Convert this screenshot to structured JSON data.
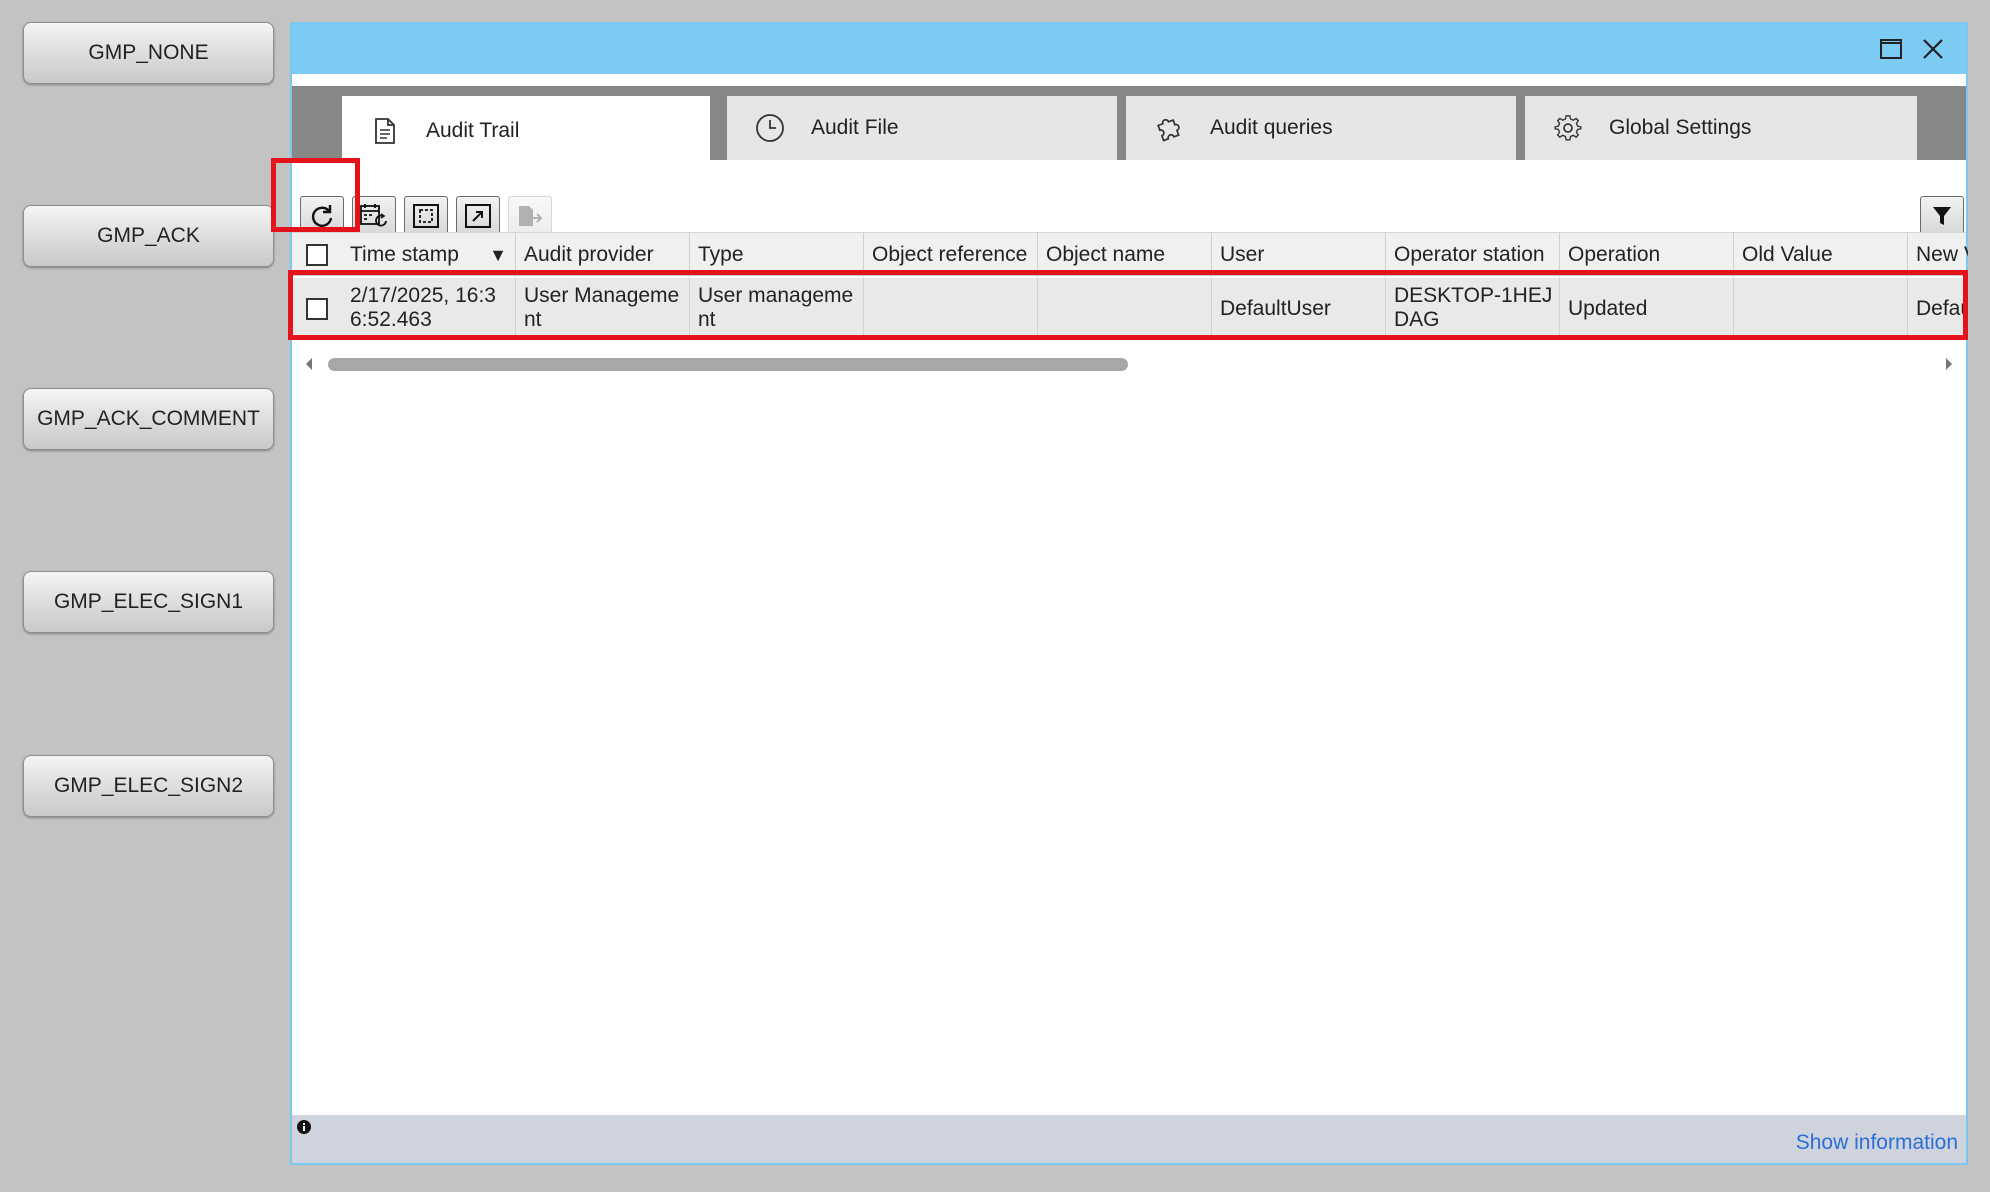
{
  "gmp_buttons": [
    {
      "label": "GMP_NONE"
    },
    {
      "label": "GMP_ACK"
    },
    {
      "label": "GMP_ACK_COMMENT"
    },
    {
      "label": "GMP_ELEC_SIGN1"
    },
    {
      "label": "GMP_ELEC_SIGN2"
    }
  ],
  "window": {
    "maximize_icon": "maximize-icon",
    "close_icon": "close-icon"
  },
  "tabs": [
    {
      "label": "Audit Trail",
      "icon": "document-icon",
      "active": true
    },
    {
      "label": "Audit File",
      "icon": "clock-icon",
      "active": false
    },
    {
      "label": "Audit queries",
      "icon": "puzzle-icon",
      "active": false
    },
    {
      "label": "Global Settings",
      "icon": "gear-icon",
      "active": false
    }
  ],
  "toolbar": {
    "buttons": [
      {
        "icon": "refresh-icon",
        "highlighted": true
      },
      {
        "icon": "calendar-refresh-icon"
      },
      {
        "icon": "select-area-icon"
      },
      {
        "icon": "move-icon"
      },
      {
        "icon": "export-icon",
        "disabled": true
      }
    ],
    "filter_icon": "filter-icon"
  },
  "grid": {
    "columns": [
      "Time stamp",
      "Audit provider",
      "Type",
      "Object reference",
      "Object name",
      "User",
      "Operator station",
      "Operation",
      "Old Value",
      "New Value"
    ],
    "sort_indicator": "▼",
    "rows": [
      {
        "time_stamp": "2/17/2025, 16:36:52.463",
        "audit_provider": "User Management",
        "type": "User management",
        "object_reference": "",
        "object_name": "",
        "user": "DefaultUser",
        "operator_station": "DESKTOP-1HEJDAG",
        "operation": "Updated",
        "old_value": "",
        "new_value": "DefaultUser"
      }
    ]
  },
  "status": {
    "info_icon": "info-icon",
    "show_information": "Show information"
  },
  "colors": {
    "title_bar": "#7ccbf3",
    "highlight": "#e3121b",
    "link": "#2a6fd6"
  }
}
